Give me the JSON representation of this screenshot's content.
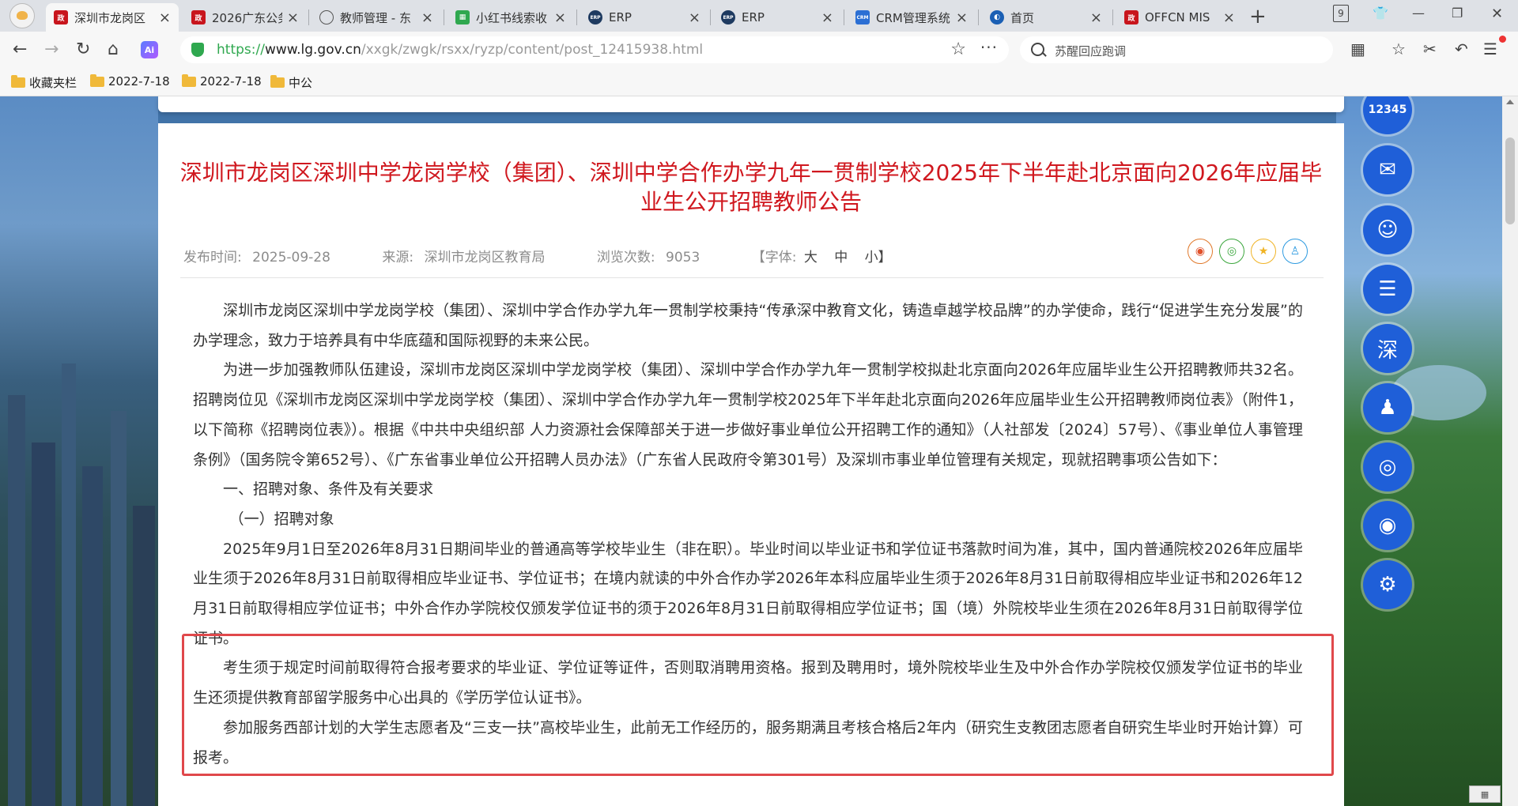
{
  "browser": {
    "tabs": [
      {
        "label": "深圳市龙岗区",
        "favicon": "red-seal-icon",
        "active": true
      },
      {
        "label": "2026广东公务",
        "favicon": "red-seal-icon"
      },
      {
        "label": "教师管理 - 东",
        "favicon": "globe-icon"
      },
      {
        "label": "小红书线索收",
        "favicon": "green-sheet-icon"
      },
      {
        "label": "ERP",
        "favicon": "erp-icon"
      },
      {
        "label": "ERP",
        "favicon": "erp-icon"
      },
      {
        "label": "CRM管理系统",
        "favicon": "crm-icon"
      },
      {
        "label": "首页",
        "favicon": "swirl-icon"
      },
      {
        "label": "OFFCN MIS",
        "favicon": "red-seal-icon"
      }
    ],
    "new_tab": "+",
    "tab_count": "9",
    "ai_label": "Ai",
    "url": {
      "scheme": "https://",
      "host": "www.lg.gov.cn",
      "path": "/xxgk/zwgk/rsxx/ryzp/content/post_12415938.html"
    },
    "search_text": "苏醒回应跑调",
    "bookmarks": [
      {
        "label": "收藏夹栏"
      },
      {
        "label": "2022-7-18"
      },
      {
        "label": "2022-7-18"
      },
      {
        "label": "中公"
      }
    ]
  },
  "article": {
    "title": "深圳市龙岗区深圳中学龙岗学校（集团）、深圳中学合作办学九年一贯制学校2025年下半年赴北京面向2026年应届毕业生公开招聘教师公告",
    "meta": {
      "publish_label": "发布时间:",
      "publish_date": "2025-09-28",
      "source_label": "来源:",
      "source": "深圳市龙岗区教育局",
      "views_label": "浏览次数:",
      "views": "9053",
      "font_open": "【字体:",
      "font_large": "大",
      "font_medium": "中",
      "font_small": "小】"
    },
    "paragraphs": [
      "深圳市龙岗区深圳中学龙岗学校（集团）、深圳中学合作办学九年一贯制学校秉持“传承深中教育文化，铸造卓越学校品牌”的办学使命，践行“促进学生充分发展”的办学理念，致力于培养具有中华底蕴和国际视野的未来公民。",
      "为进一步加强教师队伍建设，深圳市龙岗区深圳中学龙岗学校（集团）、深圳中学合作办学九年一贯制学校拟赴北京面向2026年应届毕业生公开招聘教师共32名。招聘岗位见《深圳市龙岗区深圳中学龙岗学校（集团）、深圳中学合作办学九年一贯制学校2025年下半年赴北京面向2026年应届毕业生公开招聘教师岗位表》（附件1，以下简称《招聘岗位表》）。根据《中共中央组织部 人力资源社会保障部关于进一步做好事业单位公开招聘工作的通知》（人社部发〔2024〕57号）、《事业单位人事管理条例》（国务院令第652号）、《广东省事业单位公开招聘人员办法》（广东省人民政府令第301号）及深圳市事业单位管理有关规定，现就招聘事项公告如下：",
      "一、招聘对象、条件及有关要求",
      "（一）招聘对象",
      "2025年9月1日至2026年8月31日期间毕业的普通高等学校毕业生（非在职）。毕业时间以毕业证书和学位证书落款时间为准，其中，国内普通院校2026年应届毕业生须于2026年8月31日前取得相应毕业证书、学位证书；在境内就读的中外合作办学2026年本科应届毕业生须于2026年8月31日前取得相应毕业证书和2026年12月31日前取得相应学位证书；中外合作办学院校仅颁发学位证书的须于2026年8月31日前取得相应学位证书；国（境）外院校毕业生须在2026年8月31日前取得学位证书。",
      "考生须于规定时间前取得符合报考要求的毕业证、学位证等证件，否则取消聘用资格。报到及聘用时，境外院校毕业生及中外合作办学院校仅颁发学位证书的毕业生还须提供教育部留学服务中心出具的《学历学位认证书》。",
      "参加服务西部计划的大学生志愿者及“三支一扶”高校毕业生，此前无工作经历的，服务期满且考核合格后2年内（研究生支教团志愿者自研究生毕业时开始计算）可报考。"
    ],
    "share_icons": [
      "weibo-icon",
      "wechat-icon",
      "qzone-star-icon",
      "qq-icon"
    ]
  },
  "dock": [
    {
      "name": "hotline-12345-icon",
      "glyph": "12345"
    },
    {
      "name": "mail-icon",
      "glyph": "✉"
    },
    {
      "name": "service-person-icon",
      "glyph": "☺"
    },
    {
      "name": "gov-service-icon",
      "glyph": "☰"
    },
    {
      "name": "shenzhen-icon",
      "glyph": "深"
    },
    {
      "name": "robot-assistant-icon",
      "glyph": "♟"
    },
    {
      "name": "wechat-icon",
      "glyph": "◎"
    },
    {
      "name": "weibo-icon",
      "glyph": "◉"
    },
    {
      "name": "settings-gear-icon",
      "glyph": "⚙"
    }
  ],
  "colors": {
    "title_red": "#d0181f",
    "highlight_border": "#e0484b",
    "dock_blue": "#1f5fd8",
    "url_green": "#2fa84f"
  }
}
